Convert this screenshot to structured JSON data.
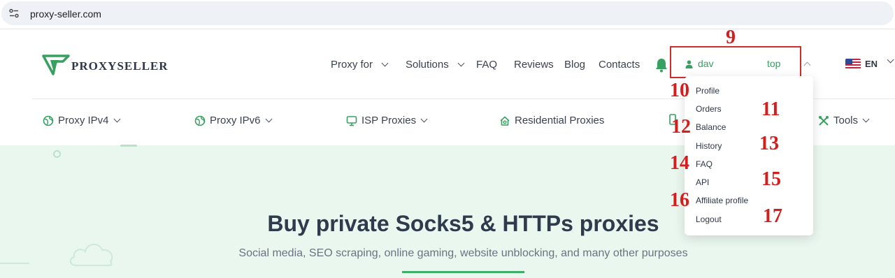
{
  "browser": {
    "url": "proxy-seller.com"
  },
  "header": {
    "logo_text": "PROXYSELLER",
    "nav": [
      {
        "label": "Proxy for",
        "has_dropdown": true
      },
      {
        "label": "Solutions",
        "has_dropdown": true
      },
      {
        "label": "FAQ",
        "has_dropdown": false
      },
      {
        "label": "Reviews",
        "has_dropdown": false
      },
      {
        "label": "Blog",
        "has_dropdown": false
      },
      {
        "label": "Contacts",
        "has_dropdown": false
      }
    ],
    "user": {
      "name_visible_start": "dav",
      "name_visible_end": "top"
    },
    "language": "EN",
    "subnav": [
      {
        "label": "Proxy IPv4",
        "icon": "globe-icon"
      },
      {
        "label": "Proxy IPv6",
        "icon": "globe-icon"
      },
      {
        "label": "ISP Proxies",
        "icon": "monitor-icon"
      },
      {
        "label": "Residential Proxies",
        "icon": "home-icon"
      },
      {
        "label": "Tools",
        "icon": "tools-icon"
      }
    ]
  },
  "user_menu": {
    "items": [
      {
        "label": "Profile",
        "marker": "10"
      },
      {
        "label": "Orders",
        "marker": "11"
      },
      {
        "label": "Balance",
        "marker": "12"
      },
      {
        "label": "History",
        "marker": "13"
      },
      {
        "label": "FAQ",
        "marker": "14"
      },
      {
        "label": "API",
        "marker": "15"
      },
      {
        "label": "Affiliate profile",
        "marker": "16"
      },
      {
        "label": "Logout",
        "marker": "17"
      }
    ]
  },
  "annotations": {
    "user_box_marker": "9"
  },
  "hero": {
    "title": "Buy private Socks5 & HTTPs proxies",
    "subtitle": "Social media, SEO scraping, online gaming, website unblocking, and many other purposes"
  },
  "colors": {
    "brand_green": "#36a160",
    "annotation_red": "#d12c2c",
    "hero_bg": "#eaf7ef"
  }
}
